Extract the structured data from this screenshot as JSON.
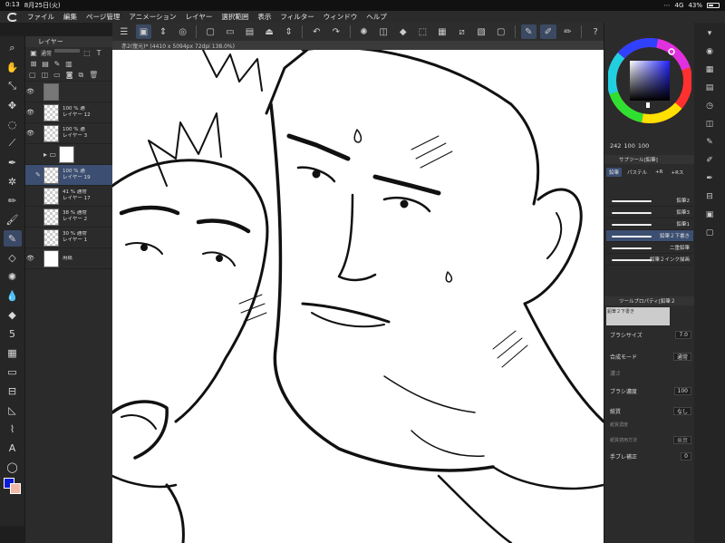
{
  "status": {
    "time": "0:13",
    "date": "8月25日(火)",
    "network": "4G",
    "battery": "43%"
  },
  "menu": [
    "ファイル",
    "編集",
    "ページ管理",
    "アニメーション",
    "レイヤー",
    "選択範囲",
    "表示",
    "フィルター",
    "ウィンドウ",
    "ヘルプ"
  ],
  "document": {
    "title": "赤2(復元)* (4410 x 5094px 72dpi 138.0%)"
  },
  "layer_panel": {
    "title": "レイヤー",
    "blend": "通常",
    "layers": [
      {
        "pct": "",
        "name": "",
        "thumb": "dark",
        "visible": true
      },
      {
        "pct": "100 % 通",
        "name": "レイヤー 12",
        "thumb": "checker",
        "visible": true
      },
      {
        "pct": "100 % 通",
        "name": "レイヤー 3",
        "thumb": "checker",
        "visible": true
      },
      {
        "pct": "",
        "name": "",
        "thumb": "folder",
        "visible": false
      },
      {
        "pct": "100 % 通",
        "name": "レイヤー 19",
        "thumb": "checker",
        "visible": false,
        "selected": true
      },
      {
        "pct": "41 % 通常",
        "name": "レイヤー 17",
        "thumb": "checker",
        "visible": false
      },
      {
        "pct": "38 % 通常",
        "name": "レイヤー 2",
        "thumb": "checker",
        "visible": false
      },
      {
        "pct": "30 % 通常",
        "name": "レイヤー 1",
        "thumb": "checker",
        "visible": false
      },
      {
        "pct": "",
        "name": "用紙",
        "thumb": "white",
        "visible": true
      }
    ]
  },
  "color": {
    "r": "242",
    "g": "100",
    "b": "100",
    "main": "#0a1bd6",
    "sub": "#f2b8a8"
  },
  "subtool": {
    "header": "サブツール[鉛筆]",
    "tabs": [
      "鉛筆",
      "パステル",
      "+R",
      "+Rス"
    ],
    "brushes": [
      "鉛筆2",
      "鉛筆3",
      "鉛筆1",
      "鉛筆２下書き",
      "二重鉛筆",
      "鉛筆２インク描画"
    ],
    "selected": "鉛筆２下書き"
  },
  "tool_property": {
    "header": "ツールプロパティ[鉛筆２",
    "preview_label": "鉛筆２下書き",
    "brush_size_label": "ブラシサイズ",
    "brush_size": "7.0",
    "blend_label": "合成モード",
    "blend": "通常",
    "thickness_label": "濃さ",
    "density_label": "ブラシ濃度",
    "density": "100",
    "paper_label": "紙質",
    "paper": "なし",
    "paper_density_label": "紙質濃度",
    "paper_method_label": "紙質適用方法",
    "paper_method": "乗算",
    "stabilize_label": "手ブレ補正",
    "stabilize": "0"
  },
  "colors": {
    "accent": "#3c4f72",
    "panel": "#2b2b2b",
    "canvas": "#ffffff"
  }
}
